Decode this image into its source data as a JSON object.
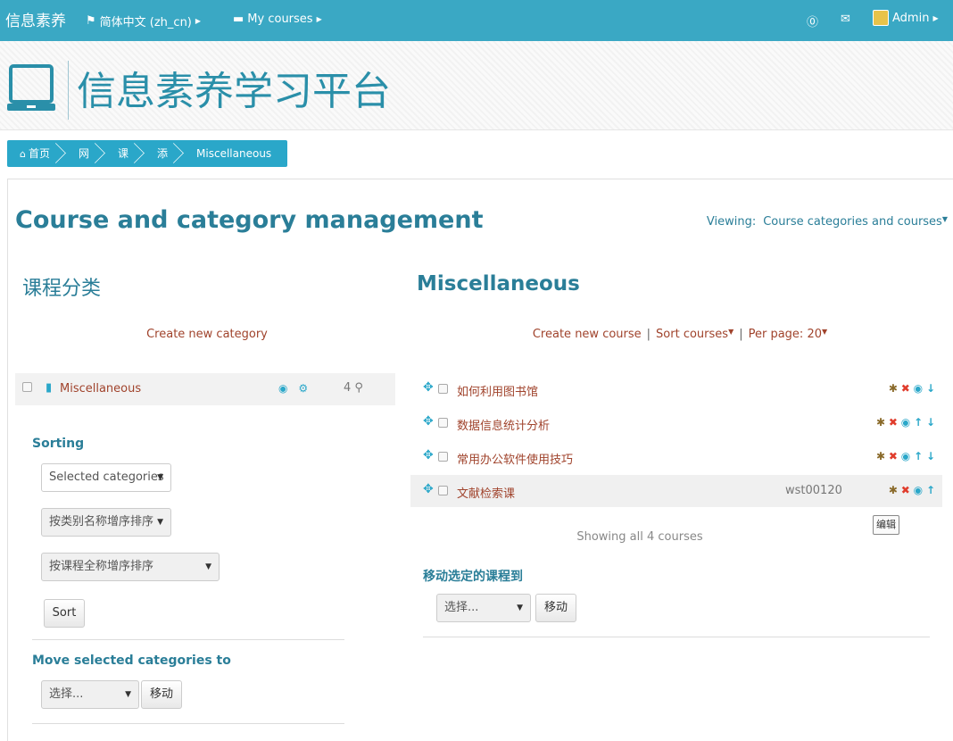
{
  "navbar": {
    "brand": "信息素养",
    "language": "简体中文 (zh_cn)",
    "my_courses": "My courses",
    "user": "Admin",
    "colors": {
      "bar": "#3aa8c4"
    }
  },
  "header": {
    "site_title": "信息素养学习平台",
    "logo_icon": "laptop-icon"
  },
  "breadcrumb": [
    "首页",
    "网",
    "课",
    "添",
    "Miscellaneous"
  ],
  "page": {
    "heading": "Course and category management",
    "viewing_label": "Viewing:",
    "viewing_value": "Course categories and courses"
  },
  "categories": {
    "title": "课程分类",
    "create_link": "Create new category",
    "items": [
      {
        "name": "Miscellaneous",
        "count": "4"
      }
    ],
    "sorting": {
      "label": "Sorting",
      "select1": "Selected categories",
      "select2": "按类别名称增序排序",
      "select3": "按课程全称增序排序",
      "sort_button": "Sort"
    },
    "move": {
      "label": "Move selected categories to",
      "select": "选择...",
      "button": "移动"
    }
  },
  "courses": {
    "title": "Miscellaneous",
    "create_link": "Create new course",
    "sort_link": "Sort courses",
    "per_page": "Per page: 20",
    "items": [
      {
        "name": "如何利用图书馆",
        "idnumber": ""
      },
      {
        "name": "数据信息统计分析",
        "idnumber": ""
      },
      {
        "name": "常用办公软件使用技巧",
        "idnumber": ""
      },
      {
        "name": "文献检索课",
        "idnumber": "wst00120"
      }
    ],
    "edit_button": "编辑",
    "showing": "Showing all 4 courses",
    "move": {
      "label": "移动选定的课程到",
      "select": "选择...",
      "button": "移动"
    }
  }
}
